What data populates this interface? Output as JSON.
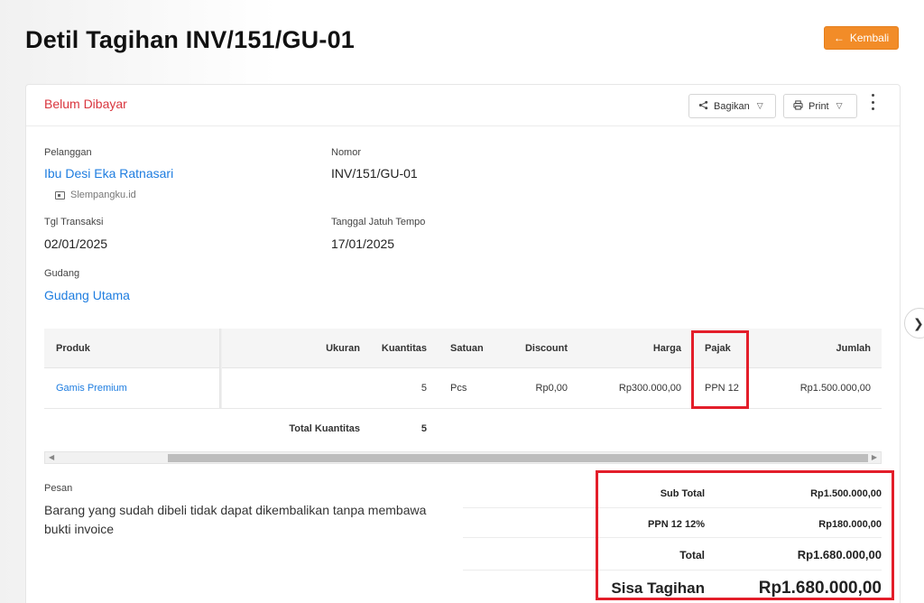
{
  "page": {
    "title": "Detil Tagihan INV/151/GU-01",
    "back_label": "Kembali"
  },
  "card": {
    "status": "Belum Dibayar",
    "share_label": "Bagikan",
    "print_label": "Print"
  },
  "info": {
    "customer_label": "Pelanggan",
    "customer": "Ibu Desi Eka Ratnasari",
    "customer_site": "Slempangku.id",
    "number_label": "Nomor",
    "number": "INV/151/GU-01",
    "date_label": "Tgl Transaksi",
    "date": "02/01/2025",
    "due_label": "Tanggal Jatuh Tempo",
    "due": "17/01/2025",
    "warehouse_label": "Gudang",
    "warehouse": "Gudang Utama"
  },
  "table": {
    "headers": [
      "Produk",
      "Ukuran",
      "Kuantitas",
      "Satuan",
      "Discount",
      "Harga",
      "Pajak",
      "Jumlah"
    ],
    "rows": [
      {
        "produk": "Gamis Premium",
        "ukuran": "",
        "kuantitas": "5",
        "satuan": "Pcs",
        "discount": "Rp0,00",
        "harga": "Rp300.000,00",
        "pajak": "PPN 12",
        "jumlah": "Rp1.500.000,00"
      }
    ],
    "total_qty_label": "Total Kuantitas",
    "total_qty": "5"
  },
  "message": {
    "label": "Pesan",
    "text": "Barang yang sudah dibeli tidak dapat dikembalikan tanpa membawa bukti invoice"
  },
  "summary": {
    "subtotal_label": "Sub Total",
    "subtotal": "Rp1.500.000,00",
    "tax_label": "PPN 12 12%",
    "tax": "Rp180.000,00",
    "total_label": "Total",
    "total": "Rp1.680.000,00",
    "remaining_label": "Sisa Tagihan",
    "remaining": "Rp1.680.000,00"
  },
  "colors": {
    "accent": "#f28c28",
    "link": "#1e7de0",
    "status": "#d9363e",
    "highlight": "#e31e2a"
  }
}
